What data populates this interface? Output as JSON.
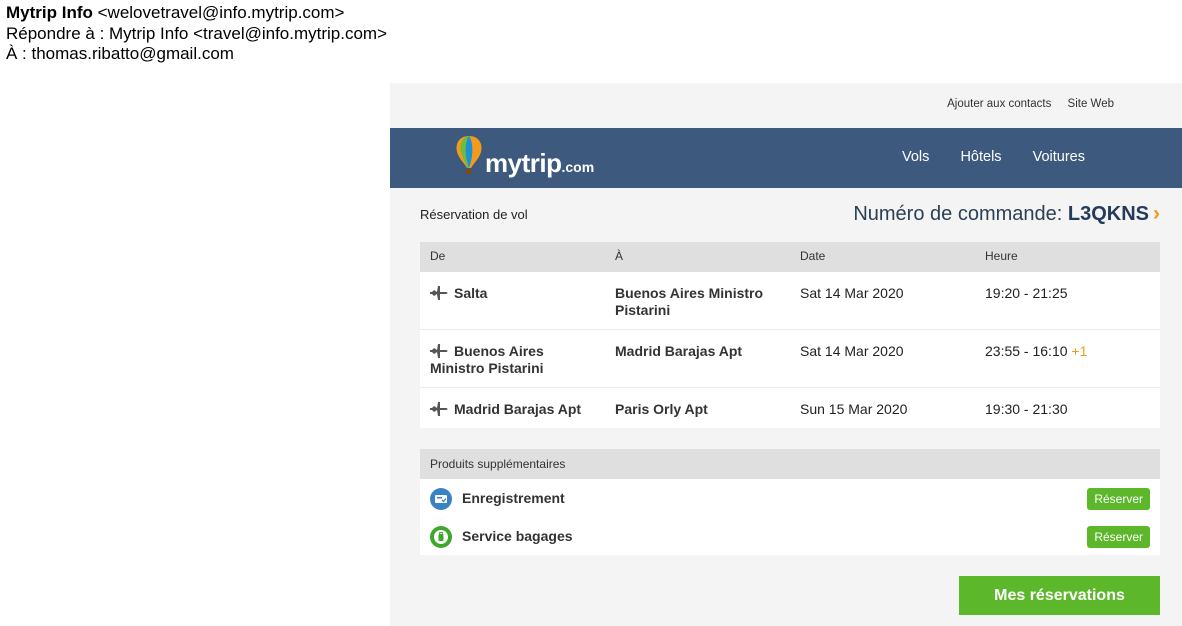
{
  "mail": {
    "from_name": "Mytrip Info",
    "from_addr": " <welovetravel@info.mytrip.com>",
    "reply_to": "Répondre à : Mytrip Info <travel@info.mytrip.com>",
    "to": "À : thomas.ribatto@gmail.com"
  },
  "top_links": {
    "add_contacts": "Ajouter aux contacts",
    "website": "Site Web"
  },
  "brand": {
    "name": "mytrip",
    "suffix": ".com"
  },
  "nav": {
    "flights": "Vols",
    "hotels": "Hôtels",
    "cars": "Voitures"
  },
  "booking": {
    "subtitle": "Réservation de vol",
    "order_label": "Numéro de commande: ",
    "order_code": "L3QKNS",
    "chevron": "›"
  },
  "table": {
    "headers": {
      "from": "De",
      "to": "À",
      "date": "Date",
      "time": "Heure"
    },
    "rows": [
      {
        "from": "Salta",
        "to": "Buenos Aires Ministro Pistarini",
        "date": "Sat 14 Mar 2020",
        "time": "19:20 - 21:25",
        "plus": ""
      },
      {
        "from": "Buenos Aires Ministro Pistarini",
        "to": "Madrid Barajas Apt",
        "date": "Sat 14 Mar 2020",
        "time": "23:55 - 16:10 ",
        "plus": "+1"
      },
      {
        "from": "Madrid Barajas Apt",
        "to": "Paris Orly Apt",
        "date": "Sun 15 Mar 2020",
        "time": "19:30 - 21:30",
        "plus": ""
      }
    ]
  },
  "extras": {
    "header": "Produits supplémentaires",
    "items": [
      {
        "label": "Enregistrement",
        "button": "Réserver"
      },
      {
        "label": "Service bagages",
        "button": "Réserver"
      }
    ]
  },
  "cta": {
    "my_bookings": "Mes réservations"
  },
  "colors": {
    "navbar": "#3d5a7e",
    "accent_orange": "#f39a1e",
    "button_green": "#5cb82a"
  }
}
